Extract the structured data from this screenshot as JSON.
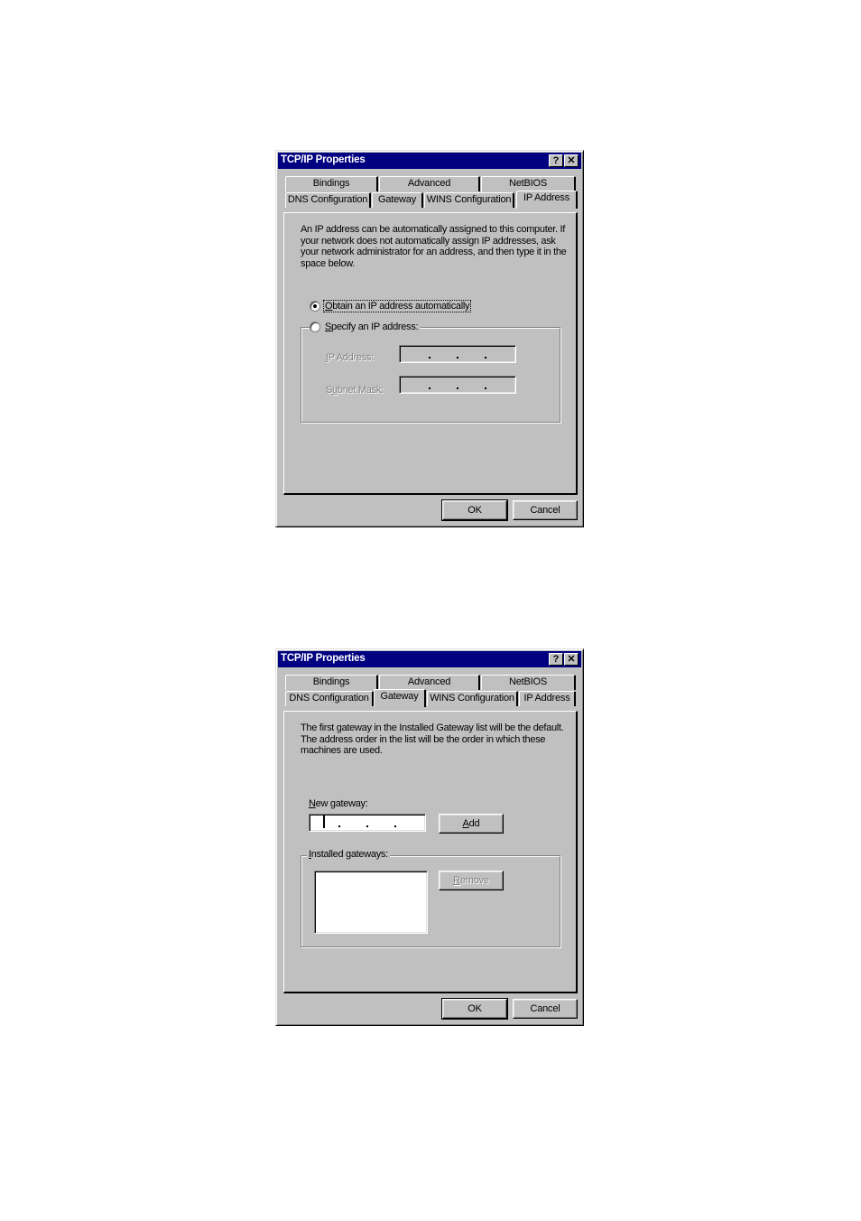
{
  "dialogs": [
    {
      "title": "TCP/IP Properties",
      "help_button": "?",
      "close_button": "✕",
      "tabs_back": [
        "Bindings",
        "Advanced",
        "NetBIOS"
      ],
      "tabs_front": [
        "DNS Configuration",
        "Gateway",
        "WINS Configuration",
        "IP Address"
      ],
      "active_tab": "IP Address",
      "description": "An IP address can be automatically assigned to this computer. If your network does not automatically assign IP addresses, ask your network administrator for an address, and then type it in the space below.",
      "radio_obtain": {
        "label": "Obtain an IP address automatically",
        "mnemonic": "O",
        "rest": "btain an IP address automatically",
        "checked": true
      },
      "radio_specify": {
        "label": "Specify an IP address:",
        "mnemonic": "S",
        "rest": "pecify an IP address:",
        "checked": false
      },
      "ip_address": {
        "label": "IP Address:",
        "mnemonic": "I",
        "rest": "P Address:",
        "value": "",
        "enabled": false
      },
      "subnet_mask": {
        "label": "Subnet Mask:",
        "pre": "S",
        "mnemonic": "u",
        "rest": "bnet Mask:",
        "value": "",
        "enabled": false
      },
      "ok_label": "OK",
      "cancel_label": "Cancel"
    },
    {
      "title": "TCP/IP Properties",
      "help_button": "?",
      "close_button": "✕",
      "tabs_back": [
        "Bindings",
        "Advanced",
        "NetBIOS"
      ],
      "tabs_front": [
        "DNS Configuration",
        "Gateway",
        "WINS Configuration",
        "IP Address"
      ],
      "active_tab": "Gateway",
      "description": "The first gateway in the Installed Gateway list will be the default. The address order in the list will be the order in which these machines are used.",
      "new_gateway": {
        "label": "New gateway:",
        "mnemonic": "N",
        "rest": "ew gateway:",
        "value": ""
      },
      "add_label": {
        "mnemonic": "A",
        "rest": "dd"
      },
      "installed_gateways": {
        "label": "Installed gateways:",
        "mnemonic": "I",
        "rest": "nstalled gateways:",
        "items": []
      },
      "remove_label": {
        "mnemonic": "R",
        "rest": "emove",
        "enabled": false
      },
      "ok_label": "OK",
      "cancel_label": "Cancel"
    }
  ]
}
